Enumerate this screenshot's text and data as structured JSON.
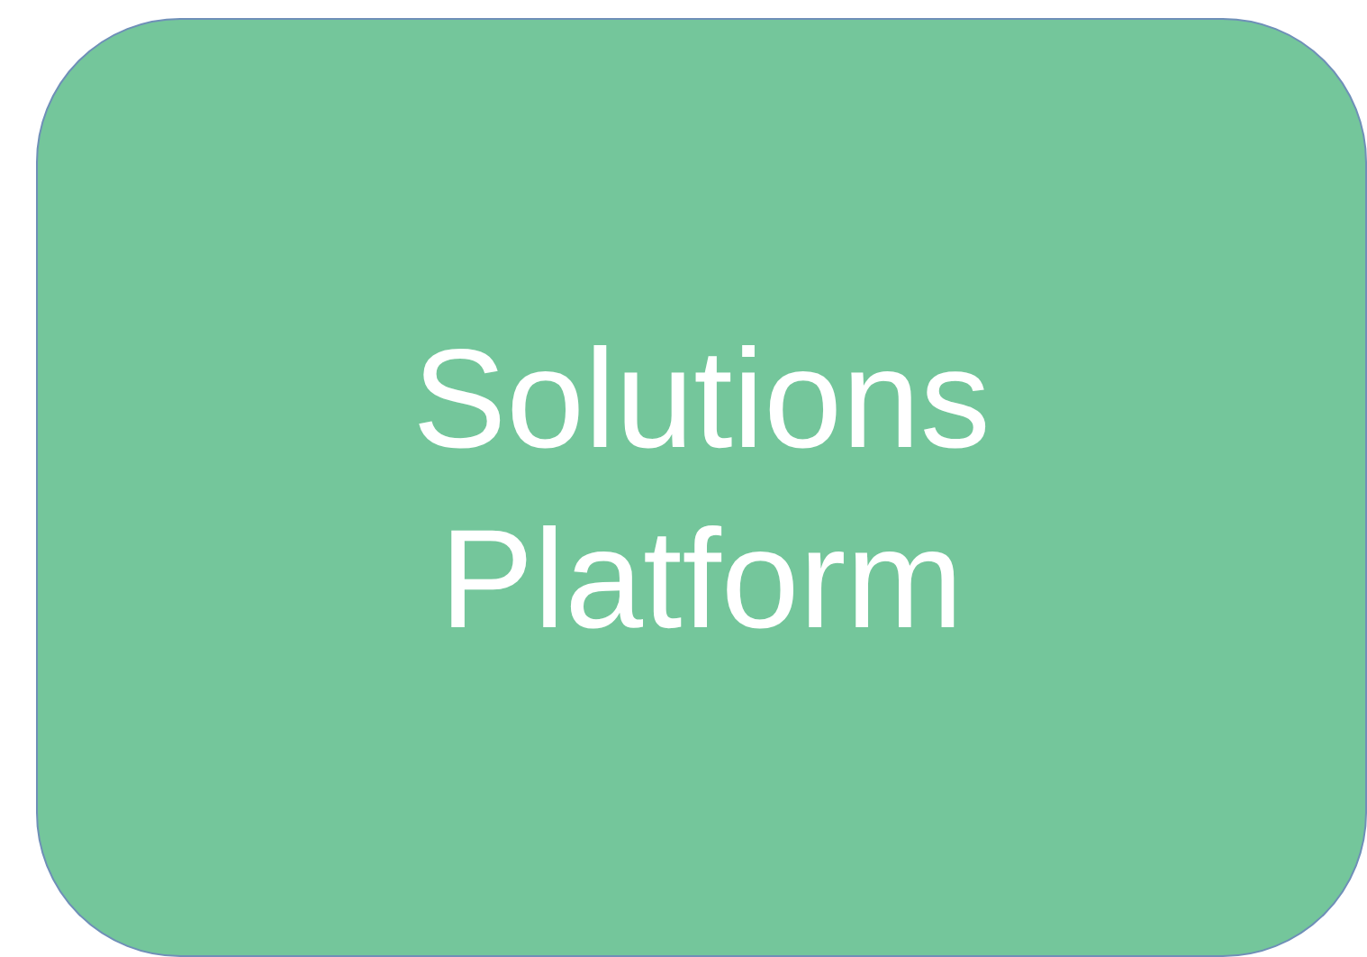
{
  "shape": {
    "label": "Solutions Platform"
  }
}
